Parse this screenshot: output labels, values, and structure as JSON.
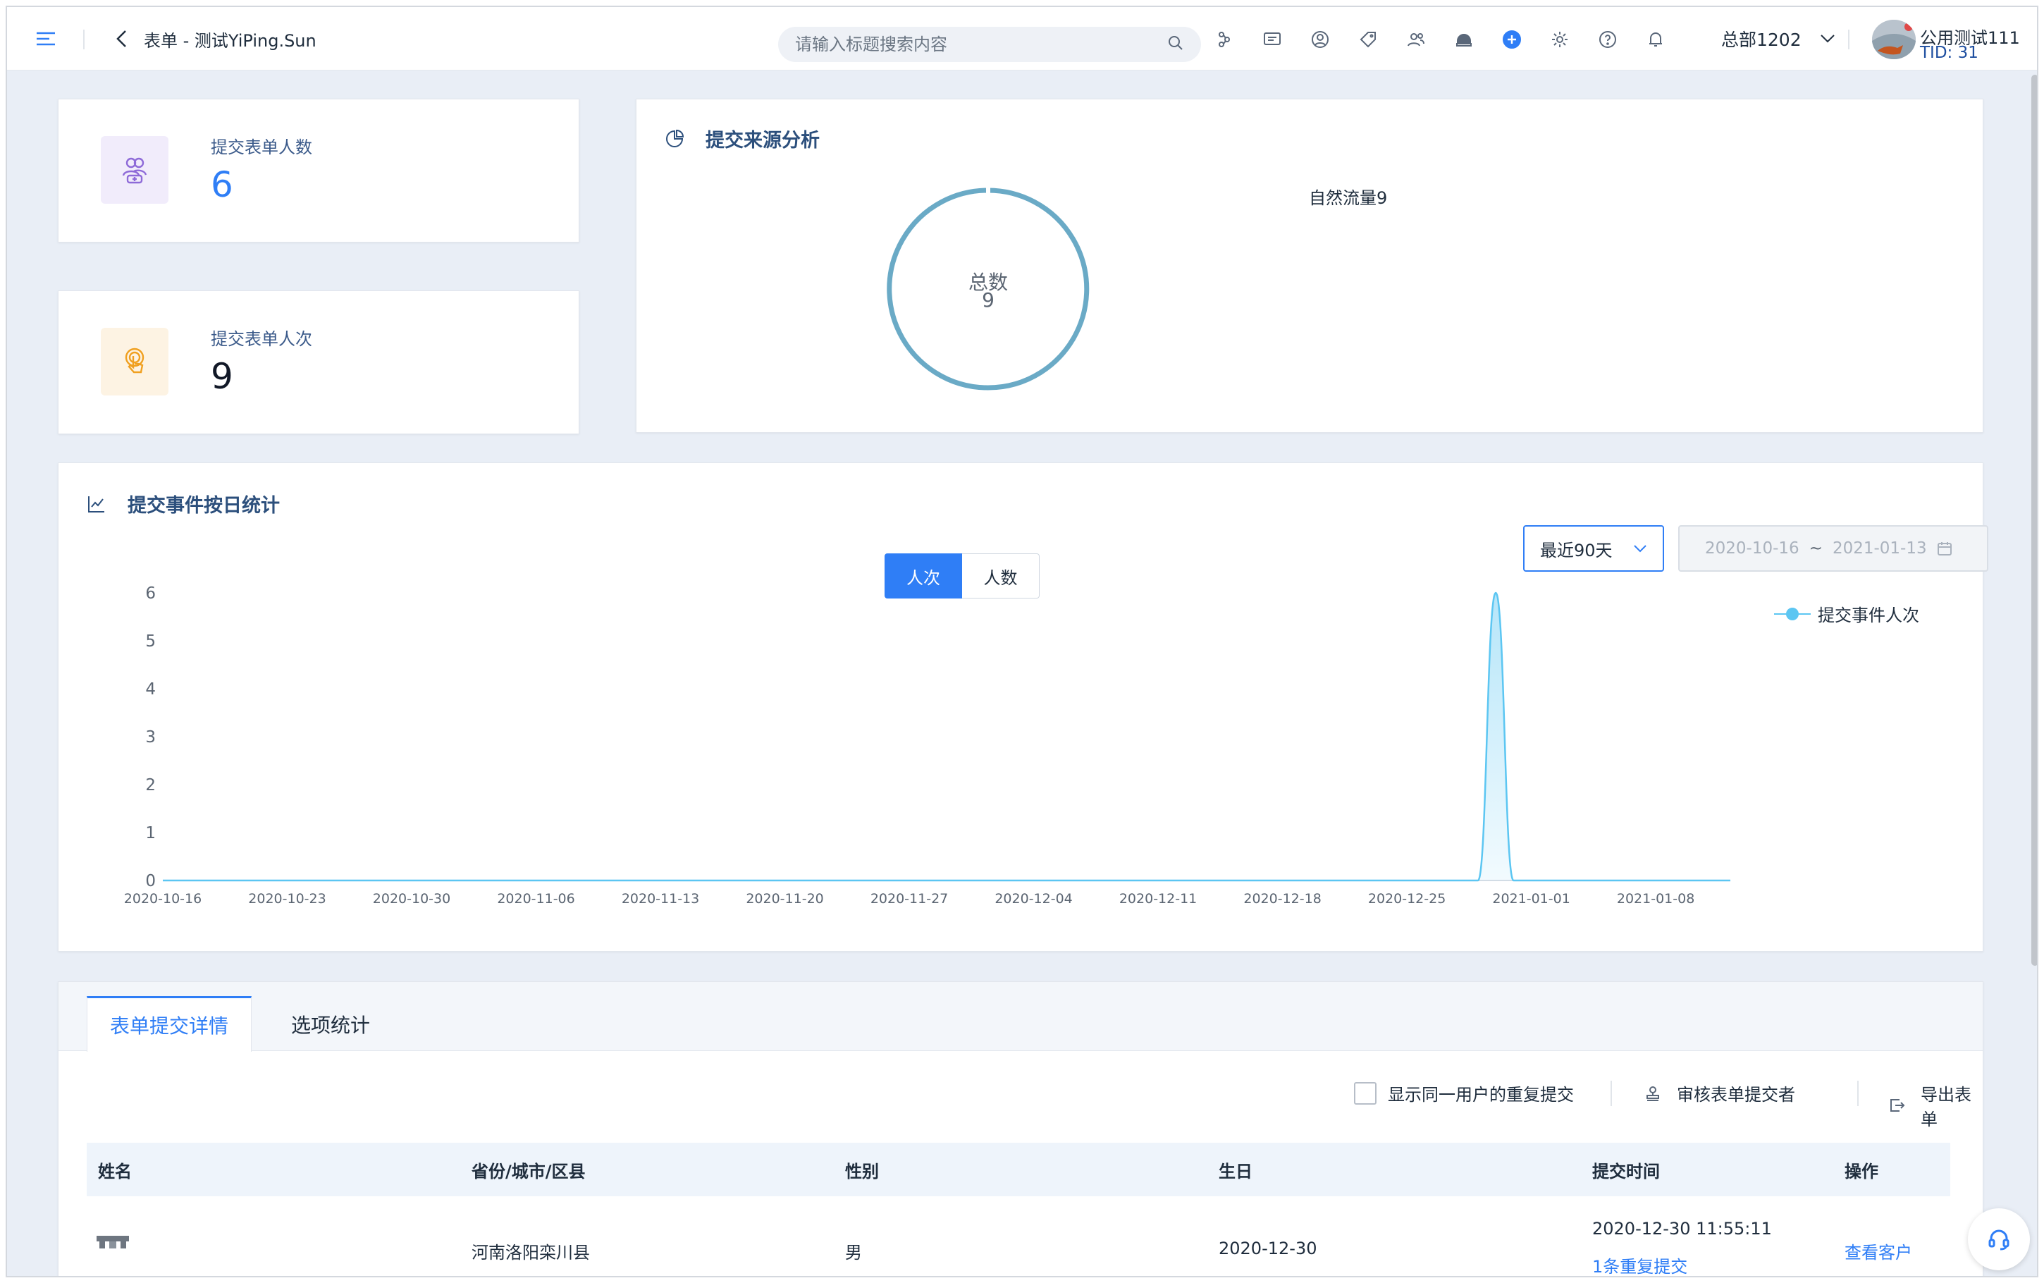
{
  "header": {
    "page_title": "表单 - 测试YiPing.Sun",
    "search_placeholder": "请输入标题搜索内容",
    "org_name": "总部1202",
    "user_name": "公用测试111",
    "user_tid": "TID: 31",
    "toolbar_icons": [
      "flow-icon",
      "message-icon",
      "user-circle-icon",
      "tag-icon",
      "contacts-icon",
      "robot-icon",
      "add-icon",
      "settings-icon",
      "help-icon",
      "bell-icon"
    ]
  },
  "stats": [
    {
      "label": "提交表单人数",
      "value": "6",
      "icon": "users-icon",
      "color": "#2f7ef6"
    },
    {
      "label": "提交表单人次",
      "value": "9",
      "icon": "hand-tap-icon",
      "color": "#111827"
    }
  ],
  "source": {
    "title": "提交来源分析",
    "center_label": "总数",
    "center_value": "9",
    "legend": "自然流量9"
  },
  "daily": {
    "title": "提交事件按日统计",
    "toggle": [
      "人次",
      "人数"
    ],
    "range_select": "最近90天",
    "date_start": "2020-10-16",
    "date_sep": "~",
    "date_end": "2021-01-13",
    "legend": "提交事件人次"
  },
  "chart_data": {
    "type": "area",
    "x": [
      "2020-10-16",
      "2020-10-23",
      "2020-10-30",
      "2020-11-06",
      "2020-11-13",
      "2020-11-20",
      "2020-11-27",
      "2020-12-04",
      "2020-12-11",
      "2020-12-18",
      "2020-12-25",
      "2021-01-01",
      "2021-01-08"
    ],
    "xticks": [
      "2020-10-16",
      "2020-10-23",
      "2020-10-30",
      "2020-11-06",
      "2020-11-13",
      "2020-11-20",
      "2020-11-27",
      "2020-12-04",
      "2020-12-11",
      "2020-12-18",
      "2020-12-25",
      "2021-01-01",
      "2021-01-08"
    ],
    "yticks": [
      "0",
      "1",
      "2",
      "3",
      "4",
      "5",
      "6"
    ],
    "series": [
      {
        "name": "提交事件人次",
        "points": [
          [
            "2020-12-27",
            0
          ],
          [
            "2020-12-28",
            0
          ],
          [
            "2020-12-29",
            0
          ],
          [
            "2020-12-30",
            6
          ],
          [
            "2020-12-31",
            0
          ],
          [
            "2021-01-01",
            0
          ]
        ]
      }
    ],
    "ylim": [
      0,
      6
    ],
    "xlim": [
      "2020-10-16",
      "2021-01-13"
    ],
    "color": "#5cc6f2"
  },
  "details": {
    "tabs": [
      "表单提交详情",
      "选项统计"
    ],
    "show_duplicates": "显示同一用户的重复提交",
    "review": "审核表单提交者",
    "export": "导出表单",
    "columns": [
      "姓名",
      "省份/城市/区县",
      "性别",
      "生日",
      "提交时间",
      "操作"
    ],
    "rows": [
      {
        "name": "",
        "region": "河南洛阳栾川县",
        "gender": "男",
        "birthday": "2020-12-30",
        "time": "2020-12-30 11:55:11",
        "dup": "1条重复提交",
        "action": "查看客户"
      }
    ]
  }
}
